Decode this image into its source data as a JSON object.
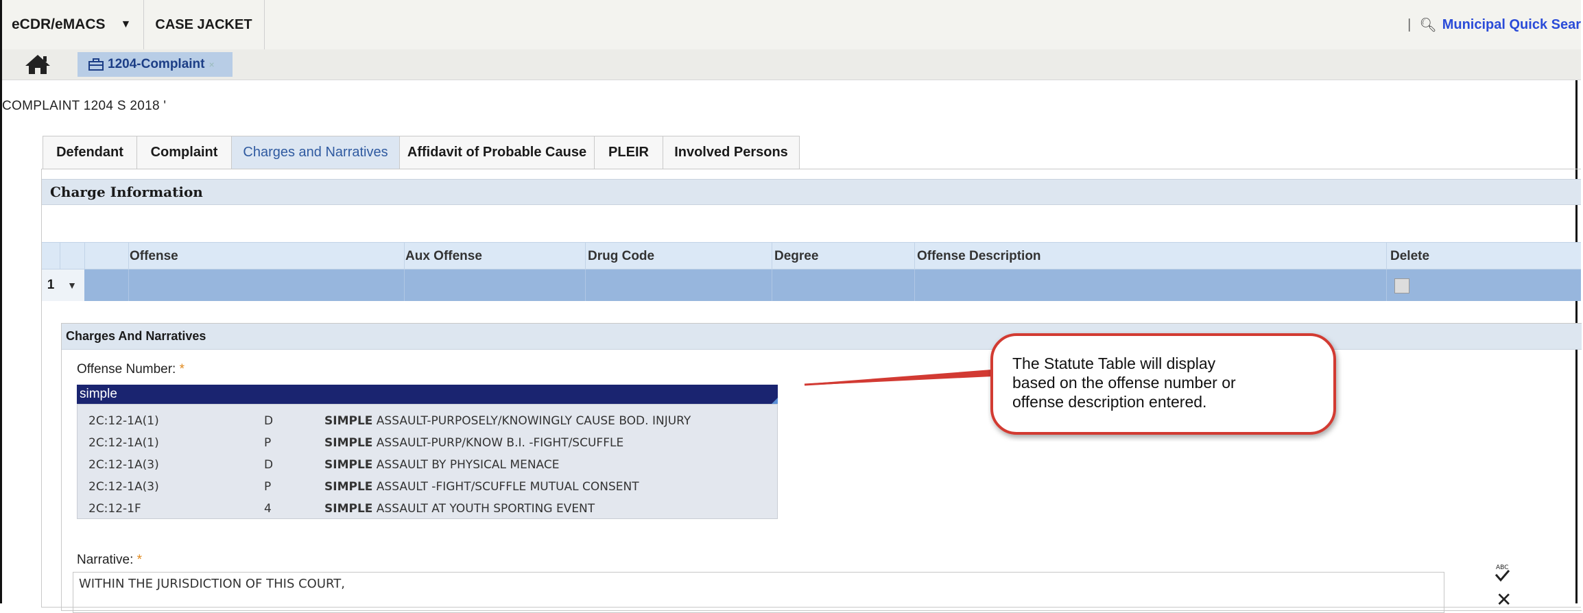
{
  "topbar": {
    "app_menu": "eCDR/eMACS",
    "case_jacket": "CASE JACKET",
    "quick_search": "Municipal Quick Sear"
  },
  "subbar": {
    "doc_tab": "1204-Complaint"
  },
  "complaint_title": "COMPLAINT 1204 S 2018 '",
  "tabs": [
    {
      "label": "Defendant"
    },
    {
      "label": "Complaint"
    },
    {
      "label": "Charges and Narratives"
    },
    {
      "label": "Affidavit of Probable Cause"
    },
    {
      "label": "PLEIR"
    },
    {
      "label": "Involved Persons"
    }
  ],
  "charge_info": {
    "header": "Charge Information",
    "columns": [
      "Offense",
      "Aux Offense",
      "Drug Code",
      "Degree",
      "Offense Description",
      "Delete"
    ],
    "row_index": "1"
  },
  "charges_narratives": {
    "header": "Charges And Narratives",
    "offense_label": "Offense Number:",
    "offense_value": "simple",
    "results": [
      {
        "code": "2C:12-1A(1)",
        "degree": "D",
        "bold": "SIMPLE",
        "desc": " ASSAULT-PURPOSELY/KNOWINGLY CAUSE BOD. INJURY"
      },
      {
        "code": "2C:12-1A(1)",
        "degree": "P",
        "bold": "SIMPLE",
        "desc": " ASSAULT-PURP/KNOW B.I. -FIGHT/SCUFFLE"
      },
      {
        "code": "2C:12-1A(3)",
        "degree": "D",
        "bold": "SIMPLE",
        "desc": " ASSAULT BY PHYSICAL MENACE"
      },
      {
        "code": "2C:12-1A(3)",
        "degree": "P",
        "bold": "SIMPLE",
        "desc": " ASSAULT -FIGHT/SCUFFLE MUTUAL CONSENT"
      },
      {
        "code": "2C:12-1F",
        "degree": "4",
        "bold": "SIMPLE",
        "desc": " ASSAULT AT YOUTH SPORTING EVENT"
      }
    ],
    "narrative_label": "Narrative:",
    "narrative_value": "WITHIN THE JURISDICTION OF THIS COURT,"
  },
  "callout": {
    "line1": "The Statute Table will display",
    "line2": "based on the offense number or",
    "line3": "offense description entered."
  },
  "colors": {
    "accent_blue": "#2f5aa0",
    "selected_row": "#97b6dd",
    "callout_border": "#d23a33"
  }
}
